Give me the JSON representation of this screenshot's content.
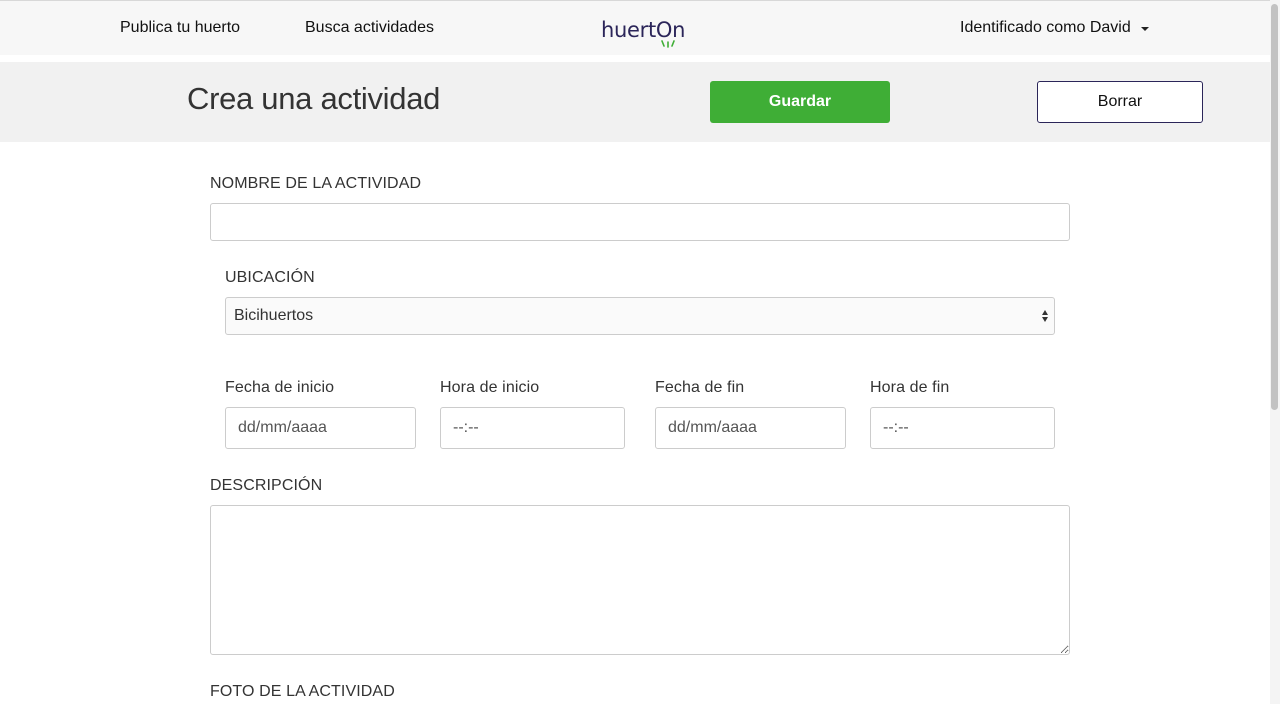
{
  "nav": {
    "publica_label": "Publica tu huerto",
    "busca_label": "Busca actividades",
    "logo_text": "huertOn",
    "user_label": "Identificado como David"
  },
  "header": {
    "title": "Crea una actividad",
    "save_label": "Guardar",
    "delete_label": "Borrar"
  },
  "form": {
    "name_label": "NOMBRE DE LA ACTIVIDAD",
    "name_value": "",
    "location_label": "UBICACIÓN",
    "location_value": "Bicihuertos",
    "start_date_label": "Fecha de inicio",
    "start_date_placeholder": "dd/mm/aaaa",
    "start_time_label": "Hora de inicio",
    "start_time_placeholder": "--:--",
    "end_date_label": "Fecha de fin",
    "end_date_placeholder": "dd/mm/aaaa",
    "end_time_label": "Hora de fin",
    "end_time_placeholder": "--:--",
    "description_label": "DESCRIPCIÓN",
    "description_value": "",
    "photo_label": "FOTO DE LA ACTIVIDAD"
  },
  "colors": {
    "accent_green": "#3fae36",
    "brand_navy": "#2b2559"
  }
}
